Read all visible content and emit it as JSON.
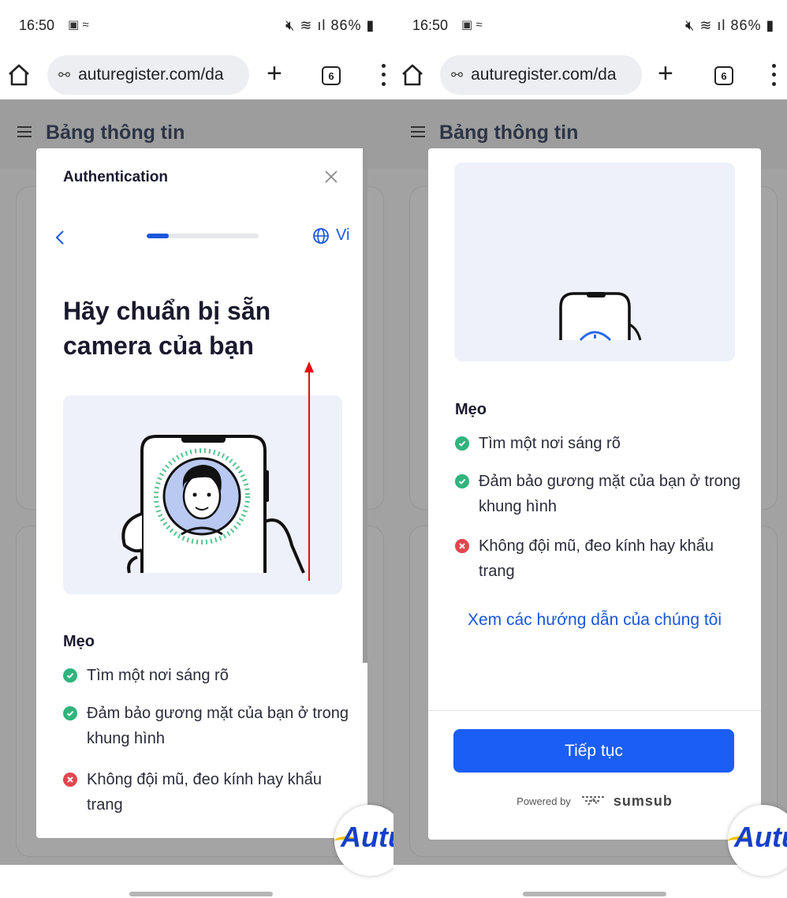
{
  "status_bar": {
    "time": "16:50",
    "battery": "86%"
  },
  "browser": {
    "url": "auturegister.com/da",
    "tab_count": "6"
  },
  "page": {
    "title": "Bảng thông tin"
  },
  "modal": {
    "title": "Authentication",
    "language": "Vi",
    "progress": 0.2,
    "heading": "Hãy chuẩn bị sẵn camera của bạn",
    "tips_title": "Mẹo",
    "tips": [
      {
        "text": "Tìm một nơi sáng rõ",
        "status": "ok"
      },
      {
        "text": "Đảm bảo gương mặt của bạn ở trong khung hình",
        "status": "ok"
      },
      {
        "text": "Không đội mũ, đeo kính hay khẩu trang",
        "status": "bad"
      }
    ],
    "guide_link": "Xem các hướng dẫn của chúng tôi",
    "continue_button": "Tiếp tục",
    "powered_by": "Powered by",
    "provider": "sumsub"
  },
  "fab": {
    "label": "Autu"
  },
  "colors": {
    "accent": "#1a5ef5",
    "ok": "#2fb47c",
    "bad": "#e3464d"
  }
}
